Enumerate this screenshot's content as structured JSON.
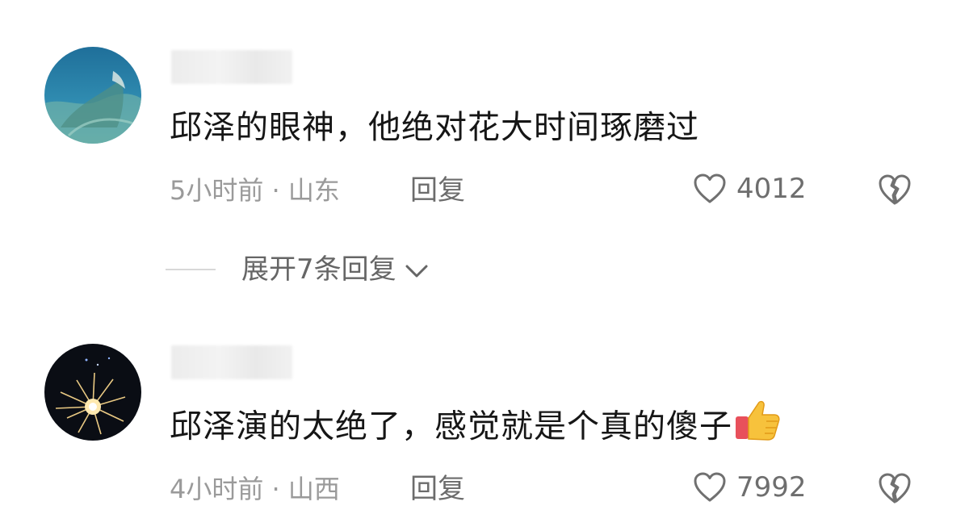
{
  "comments": [
    {
      "text": "邱泽的眼神，他绝对花大时间琢磨过",
      "time_location": "5小时前 · 山东",
      "reply_label": "回复",
      "likes": "4012",
      "avatar_icon": "ocean-scene-avatar"
    },
    {
      "text": "邱泽演的太绝了，感觉就是个真的傻子",
      "emoji": "thumbs-up-emoji",
      "time_location": "4小时前 · 山西",
      "reply_label": "回复",
      "likes": "7992",
      "avatar_icon": "fireworks-avatar"
    }
  ],
  "expand_replies_label": "展开7条回复",
  "colors": {
    "text": "#161616",
    "meta": "#9a9a9a",
    "action": "#6c6c6c"
  }
}
